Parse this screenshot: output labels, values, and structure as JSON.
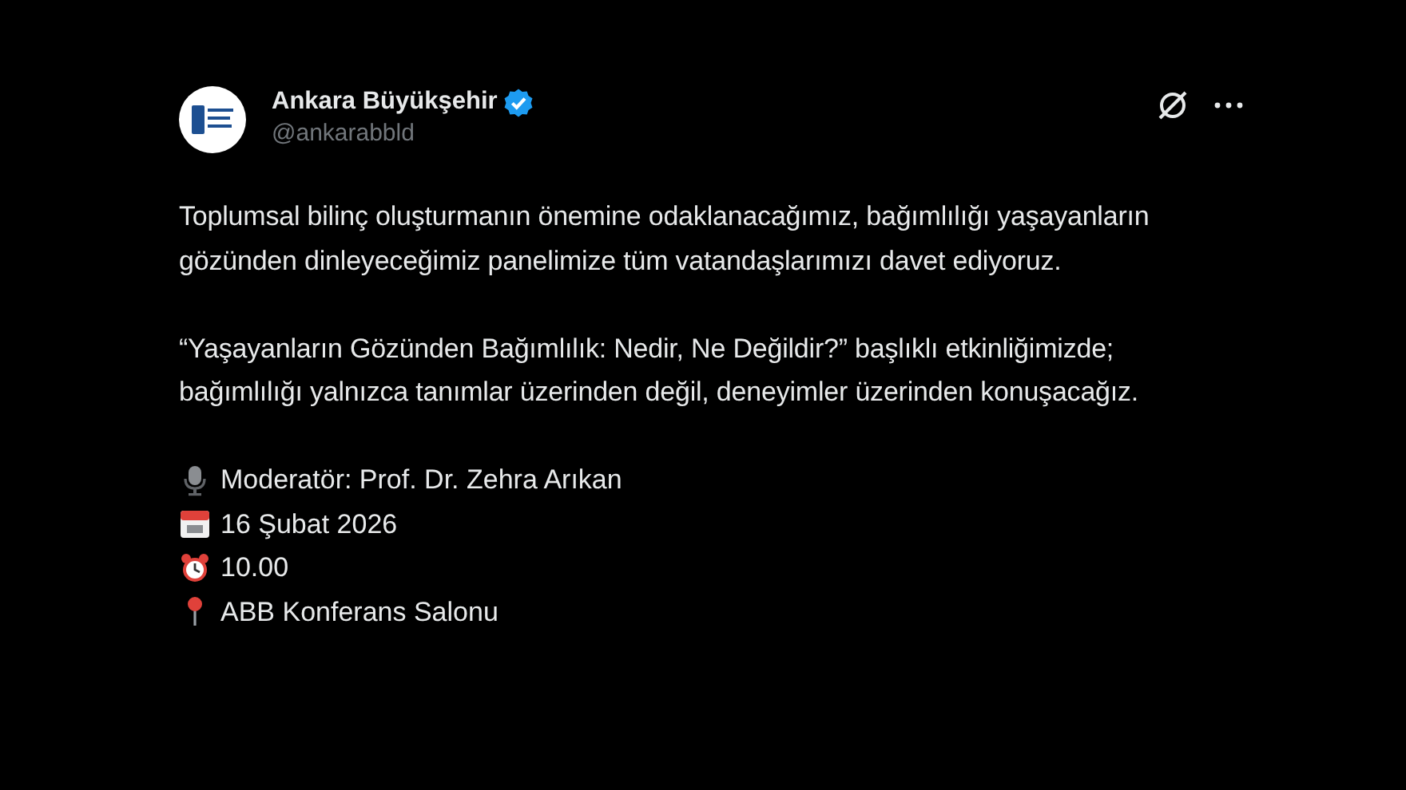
{
  "account": {
    "name": "Ankara Büyükşehir",
    "handle": "@ankarabbld",
    "verified": true
  },
  "paragraphs": [
    "Toplumsal bilinç oluşturmanın önemine odaklanacağımız, bağımlılığı yaşayanların gözünden dinleyeceğimiz panelimize tüm vatandaşlarımızı davet ediyoruz.",
    "“Yaşayanların Gözünden Bağımlılık: Nedir, Ne Değildir?” başlıklı etkinliğimizde; bağımlılığı yalnızca tanımlar üzerinden değil, deneyimler üzerinden konuşacağız."
  ],
  "details": [
    {
      "kind": "microphone",
      "text": "Moderatör: Prof. Dr. Zehra Arıkan"
    },
    {
      "kind": "calendar",
      "text": "16 Şubat 2026"
    },
    {
      "kind": "alarm",
      "text": "10.00"
    },
    {
      "kind": "pin",
      "text": "ABB Konferans Salonu"
    }
  ]
}
